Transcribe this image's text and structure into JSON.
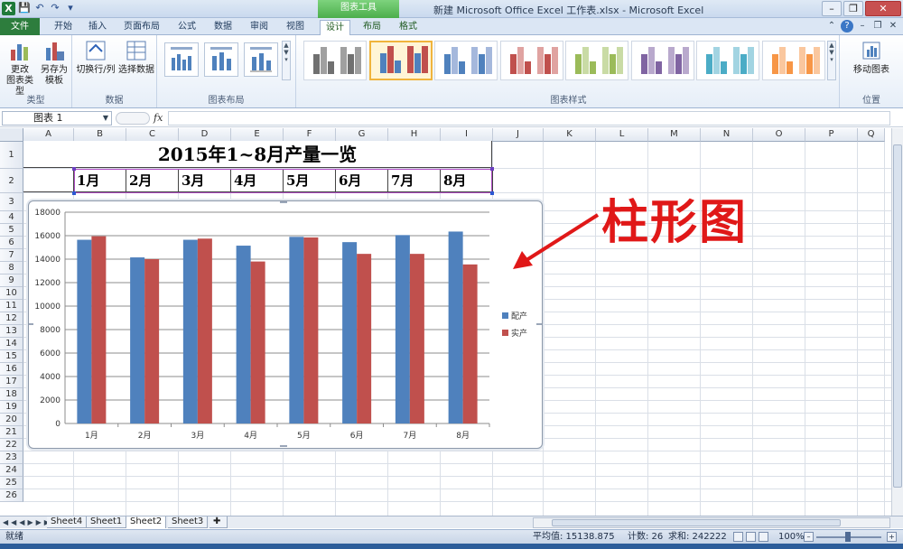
{
  "app": {
    "window_title": "新建 Microsoft Office Excel 工作表.xlsx - Microsoft Excel",
    "chart_tools_label": "图表工具",
    "logo_letter": "X"
  },
  "tabs": {
    "file": "文件",
    "items": [
      "开始",
      "插入",
      "页面布局",
      "公式",
      "数据",
      "审阅",
      "视图"
    ],
    "chart_tabs": [
      "设计",
      "布局",
      "格式"
    ],
    "active": "设计"
  },
  "ribbon": {
    "change_type_line1": "更改",
    "change_type_line2": "图表类型",
    "save_template_line1": "另存为",
    "save_template_line2": "模板",
    "switch_row_col": "切换行/列",
    "select_data": "选择数据",
    "move_chart": "移动图表",
    "groups": {
      "type": "类型",
      "data": "数据",
      "layout": "图表布局",
      "styles": "图表样式",
      "location": "位置"
    },
    "style_palettes": [
      [
        "#707070",
        "#a0a0a0"
      ],
      [
        "#4f81bd",
        "#c0504d"
      ],
      [
        "#4f81bd",
        "#a5b8dc"
      ],
      [
        "#c0504d",
        "#e0a3a1"
      ],
      [
        "#9bbb59",
        "#c9dba5"
      ],
      [
        "#8064a2",
        "#b9a9cd"
      ],
      [
        "#4bacc6",
        "#a2d4e2"
      ],
      [
        "#f79646",
        "#fac79e"
      ]
    ],
    "selected_style_index": 1
  },
  "formula_bar": {
    "name_box": "图表 1",
    "fx": "fx",
    "value": ""
  },
  "columns": [
    "A",
    "B",
    "C",
    "D",
    "E",
    "F",
    "G",
    "H",
    "I",
    "J",
    "K",
    "L",
    "M",
    "N",
    "O",
    "P",
    "Q"
  ],
  "rows": [
    "1",
    "2",
    "3",
    "4",
    "5",
    "6",
    "7",
    "8",
    "9",
    "10",
    "11",
    "12",
    "13",
    "14",
    "15",
    "16",
    "17",
    "18",
    "19",
    "20",
    "21",
    "22",
    "23",
    "24",
    "25",
    "26"
  ],
  "sheet": {
    "title": "2015年1~8月产量一览",
    "months": [
      "1月",
      "2月",
      "3月",
      "4月",
      "5月",
      "6月",
      "7月",
      "8月"
    ]
  },
  "annotation": {
    "text": "柱形图",
    "color": "#e01818"
  },
  "chart_data": {
    "type": "bar",
    "categories": [
      "1月",
      "2月",
      "3月",
      "4月",
      "5月",
      "6月",
      "7月",
      "8月"
    ],
    "series": [
      {
        "name": "配产",
        "color": "#4f81bd",
        "values": [
          15650,
          14150,
          15650,
          15150,
          15900,
          15450,
          16050,
          16350
        ]
      },
      {
        "name": "实产",
        "color": "#c0504d",
        "values": [
          15950,
          14000,
          15750,
          13800,
          15850,
          14450,
          14450,
          13550
        ]
      }
    ],
    "ylim": [
      0,
      18000
    ],
    "yticks": [
      "0",
      "2000",
      "4000",
      "6000",
      "8000",
      "10000",
      "12000",
      "14000",
      "16000",
      "18000"
    ],
    "grid": true,
    "legend": "right",
    "title": "",
    "xlabel": "",
    "ylabel": ""
  },
  "sheet_tabs": {
    "items": [
      "Sheet4",
      "Sheet1",
      "Sheet2",
      "Sheet3"
    ],
    "active": "Sheet2"
  },
  "status": {
    "ready": "就绪",
    "average": "平均值: 15138.875",
    "count": "计数: 26",
    "sum": "求和: 242222",
    "zoom": "100%"
  }
}
